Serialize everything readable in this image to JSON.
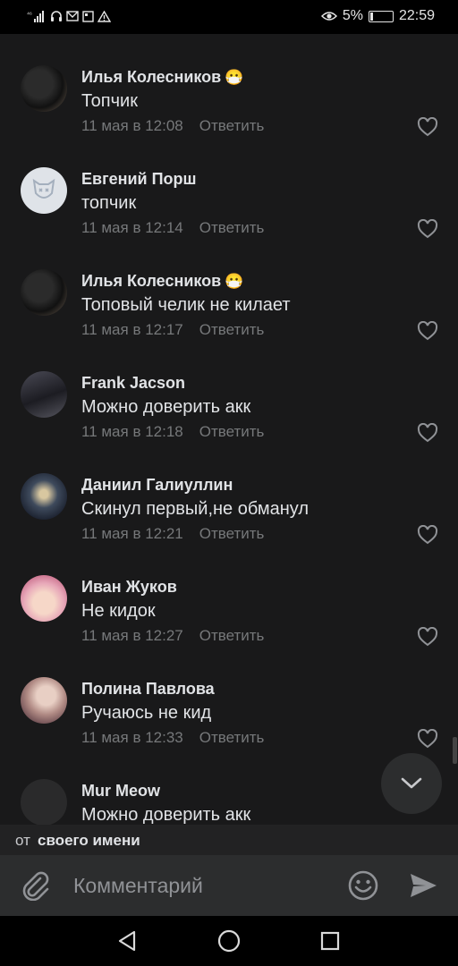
{
  "status_bar": {
    "signal": "⁴⁶",
    "battery": "5%",
    "time": "22:59"
  },
  "comments": [
    {
      "author": "Илья Колесников",
      "emoji": "😷",
      "text": "Топчик",
      "time": "11 мая в 12:08",
      "reply": "Ответить",
      "avatar": "avatar-photo-dark"
    },
    {
      "author": "Евгений Порш",
      "emoji": "",
      "text": "топчик",
      "time": "11 мая в 12:14",
      "reply": "Ответить",
      "avatar": "avatar-default-dog"
    },
    {
      "author": "Илья Колесников",
      "emoji": "😷",
      "text": "Топовый челик не килает",
      "time": "11 мая в 12:17",
      "reply": "Ответить",
      "avatar": "avatar-photo-dark"
    },
    {
      "author": "Frank Jacson",
      "emoji": "",
      "text": "Можно доверить акк",
      "time": "11 мая в 12:18",
      "reply": "Ответить",
      "avatar": "avatar-photo-car"
    },
    {
      "author": "Даниил Галиуллин",
      "emoji": "",
      "text": "Скинул первый,не обманул",
      "time": "11 мая в 12:21",
      "reply": "Ответить",
      "avatar": "avatar-photo-sunset"
    },
    {
      "author": "Иван Жуков",
      "emoji": "",
      "text": "Не кидок",
      "time": "11 мая в 12:27",
      "reply": "Ответить",
      "avatar": "avatar-photo-anime"
    },
    {
      "author": "Полина Павлова",
      "emoji": "",
      "text": "Ручаюсь не кид",
      "time": "11 мая в 12:33",
      "reply": "Ответить",
      "avatar": "avatar-photo-girl"
    },
    {
      "author": "Mur Meow",
      "emoji": "",
      "text": "Можно доверить акк",
      "time": "",
      "reply": "",
      "avatar": "avatar-empty"
    }
  ],
  "from_bar": {
    "prefix": "от",
    "name": "своего имени"
  },
  "composer": {
    "placeholder": "Комментарий"
  },
  "icons": {
    "attach": "paperclip-icon",
    "emoji": "smiley-icon",
    "send": "send-icon",
    "like": "heart-icon",
    "scroll_down": "chevron-down-icon",
    "nav_back": "triangle-back-icon",
    "nav_home": "circle-home-icon",
    "nav_recent": "square-recent-icon"
  },
  "colors": {
    "background": "#19191a",
    "text": "#e1e3e6",
    "secondary": "#76787a",
    "panel": "#2c2d2e"
  }
}
